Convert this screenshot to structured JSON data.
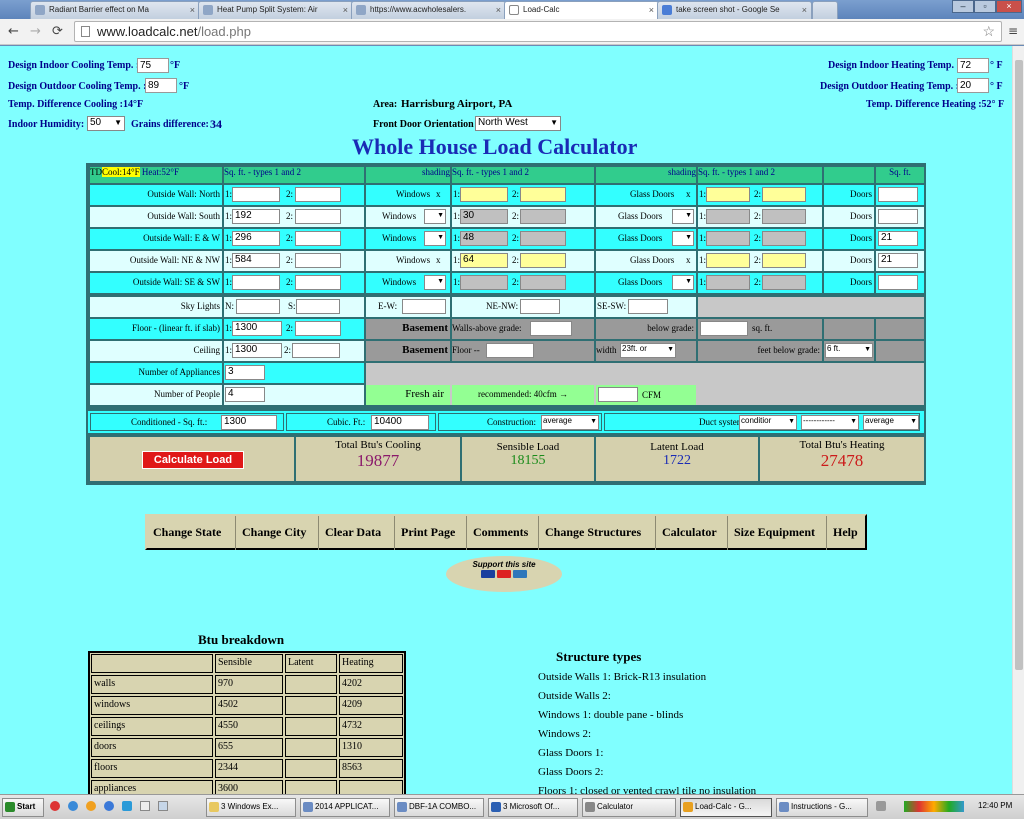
{
  "browser": {
    "tabs": [
      {
        "label": "Radiant Barrier effect on Ma"
      },
      {
        "label": "Heat Pump Split System: Air"
      },
      {
        "label": "https://www.acwholesalers."
      },
      {
        "label": "Load-Calc"
      },
      {
        "label": "take screen shot - Google Se"
      }
    ],
    "url_host": "www.loadcalc.net",
    "url_path": "/load.php"
  },
  "design": {
    "indoor_cooling_label": "Design Indoor Cooling Temp. :",
    "indoor_cooling_value": "75",
    "outdoor_cooling_label": "Design Outdoor Cooling Temp. :",
    "outdoor_cooling_value": "89",
    "unit": "°F",
    "temp_diff_cooling": "Temp. Difference Cooling :14°F",
    "humidity_label": "Indoor Humidity:",
    "humidity_value": "50",
    "grains_label": "Grains difference:",
    "grains_value": "34",
    "area_label": "Area:",
    "area_value": "Harrisburg Airport, PA",
    "door_orient_label": "Front Door Orientation",
    "door_orient_value": "North West",
    "indoor_heating_label": "Design Indoor Heating Temp. :",
    "indoor_heating_value": "72",
    "outdoor_heating_label": "Design Outdoor Heating Temp. :",
    "outdoor_heating_value": "20",
    "unit_f": "° F",
    "temp_diff_heating": "Temp. Difference Heating :52° F"
  },
  "title": "Whole House Load Calculator",
  "table": {
    "td": "TD",
    "cool": "Cool:14°F",
    "heat": "Heat:52°F",
    "sqft_types": "Sq. ft. - types 1 and 2",
    "shading": "shading",
    "sqft": "Sq. ft.",
    "rows": [
      {
        "label": "Outside Wall: North",
        "w1": "",
        "w2": "",
        "win_label": "Windows",
        "win1": "",
        "win2": "",
        "gd_label": "Glass Doors",
        "gd1": "",
        "gd2": "",
        "door": ""
      },
      {
        "label": "Outside Wall: South",
        "w1": "192",
        "w2": "",
        "win_label": "Windows",
        "win1": "30",
        "win2": "",
        "gd_label": "Glass Doors",
        "gd1": "",
        "gd2": "",
        "door": ""
      },
      {
        "label": "Outside Wall: E & W",
        "w1": "296",
        "w2": "",
        "win_label": "Windows",
        "win1": "48",
        "win2": "",
        "gd_label": "Glass Doors",
        "gd1": "",
        "gd2": "",
        "door": "21"
      },
      {
        "label": "Outside Wall: NE & NW",
        "w1": "584",
        "w2": "",
        "win_label": "Windows",
        "win1": "64",
        "win2": "",
        "gd_label": "Glass Doors",
        "gd1": "",
        "gd2": "",
        "door": "21"
      },
      {
        "label": "Outside Wall: SE & SW",
        "w1": "",
        "w2": "",
        "win_label": "Windows",
        "win1": "",
        "win2": "",
        "gd_label": "Glass Doors",
        "gd1": "",
        "gd2": "",
        "door": ""
      }
    ],
    "doors": "Doors",
    "sky_lights": "Sky Lights",
    "ew": "E-W:",
    "nenw": "NE-NW:",
    "sesw": "SE-SW:",
    "floor_label": "Floor - (linear ft. if slab)",
    "floor_value": "1300",
    "ceiling_label": "Ceiling",
    "ceiling_value": "1300",
    "basement": "Basement",
    "walls_above": "Walls-above grade:",
    "below_grade": "below grade:",
    "sqft_dot": "sq. ft.",
    "floor_dash": "Floor --",
    "width": "width",
    "width_value": "23ft. or",
    "feet_below": "feet below grade:",
    "feet_below_value": "6 ft.",
    "appliances_label": "Number of Appliances",
    "appliances_value": "3",
    "people_label": "Number of People",
    "people_value": "4",
    "fresh_air": "Fresh air",
    "recommended": "recommended: 40cfm →",
    "cfm": "CFM",
    "cond_sqft_label": "Conditioned - Sq. ft.:",
    "cond_sqft_value": "1300",
    "cubic_label": "Cubic. Ft.:",
    "cubic_value": "10400",
    "construction_label": "Construction:",
    "construction_value": "average",
    "duct_label": "Duct system:",
    "duct_value1": "conditior",
    "duct_value2": "------------",
    "duct_value3": "average",
    "n1": "1:",
    "n2": "2:",
    "x": "x",
    "north_n": "N:",
    "south_s": "S:"
  },
  "results": {
    "calc_button": "Calculate Load",
    "cooling_label": "Total Btu's Cooling",
    "cooling_value": "19877",
    "sensible_label": "Sensible Load",
    "sensible_value": "18155",
    "latent_label": "Latent Load",
    "latent_value": "1722",
    "heating_label": "Total Btu's Heating",
    "heating_value": "27478"
  },
  "menu": [
    "Change State",
    "Change City",
    "Clear Data",
    "Print Page",
    "Comments",
    "Change Structures",
    "Calculator",
    "Size Equipment",
    "Help"
  ],
  "support": "Support this site",
  "breakdown": {
    "title": "Btu breakdown",
    "headers": [
      "",
      "Sensible",
      "Latent",
      "Heating"
    ],
    "rows": [
      [
        "walls",
        "970",
        "",
        "4202"
      ],
      [
        "windows",
        "4502",
        "",
        "4209"
      ],
      [
        "ceilings",
        "4550",
        "",
        "4732"
      ],
      [
        "doors",
        "655",
        "",
        "1310"
      ],
      [
        "floors",
        "2344",
        "",
        "8563"
      ],
      [
        "appliances",
        "3600",
        "",
        ""
      ]
    ]
  },
  "structure": {
    "title": "Structure types",
    "items": [
      "Outside Walls 1: Brick-R13 insulation",
      "Outside Walls 2:",
      "Windows 1: double pane - blinds",
      "Windows 2:",
      "Glass Doors 1:",
      "Glass Doors 2:",
      "Floors 1: closed or vented crawl tile no insulation"
    ]
  },
  "taskbar": {
    "start": "Start",
    "items": [
      "3 Windows Ex...",
      "2014 APPLICAT...",
      "DBF-1A COMBO...",
      "3 Microsoft Of...",
      "Calculator",
      "Load-Calc - G...",
      "Instructions - G..."
    ],
    "clock": "12:40 PM"
  },
  "colors": {
    "page_bg": "#80ffff",
    "title": "#1a2bb5",
    "label": "#00008b",
    "cooling": "#8b1a6b",
    "sensible": "#1a8b1a",
    "latent": "#1a2bb5",
    "heating": "#cc1a1a"
  }
}
